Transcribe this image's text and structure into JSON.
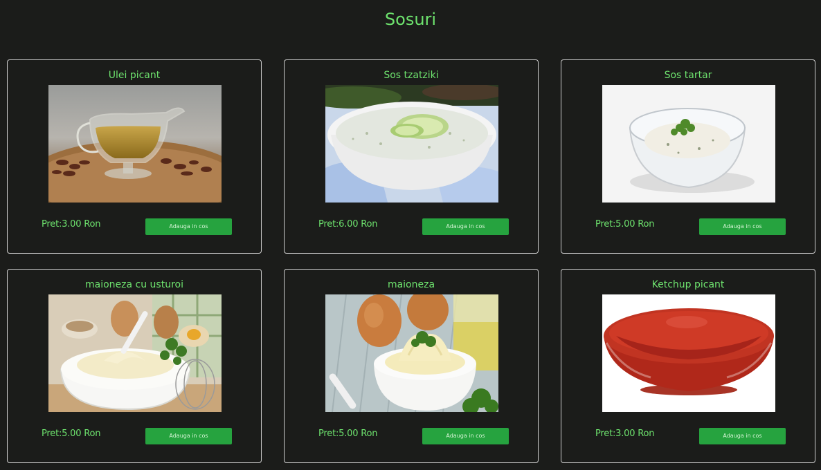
{
  "page": {
    "title": "Sosuri"
  },
  "products": [
    {
      "name": "Ulei picant",
      "price": "Pret:3.00 Ron",
      "button": "Adauga in cos",
      "image": "oil-gravy-boat-image"
    },
    {
      "name": "Sos tzatziki",
      "price": "Pret:6.00 Ron",
      "button": "Adauga in cos",
      "image": "tzatziki-bowl-image"
    },
    {
      "name": "Sos tartar",
      "price": "Pret:5.00 Ron",
      "button": "Adauga in cos",
      "image": "tartar-glass-bowl-image"
    },
    {
      "name": "maioneza cu usturoi",
      "price": "Pret:5.00 Ron",
      "button": "Adauga in cos",
      "image": "garlic-mayo-bowl-image"
    },
    {
      "name": "maioneza",
      "price": "Pret:5.00 Ron",
      "button": "Adauga in cos",
      "image": "mayo-cup-eggs-image"
    },
    {
      "name": "Ketchup picant",
      "price": "Pret:3.00 Ron",
      "button": "Adauga in cos",
      "image": "ketchup-bowl-image"
    }
  ],
  "colors": {
    "background": "#1b1c1a",
    "accent_text": "#6ee36e",
    "button": "#26a33f",
    "card_border": "#cfcfcf"
  }
}
